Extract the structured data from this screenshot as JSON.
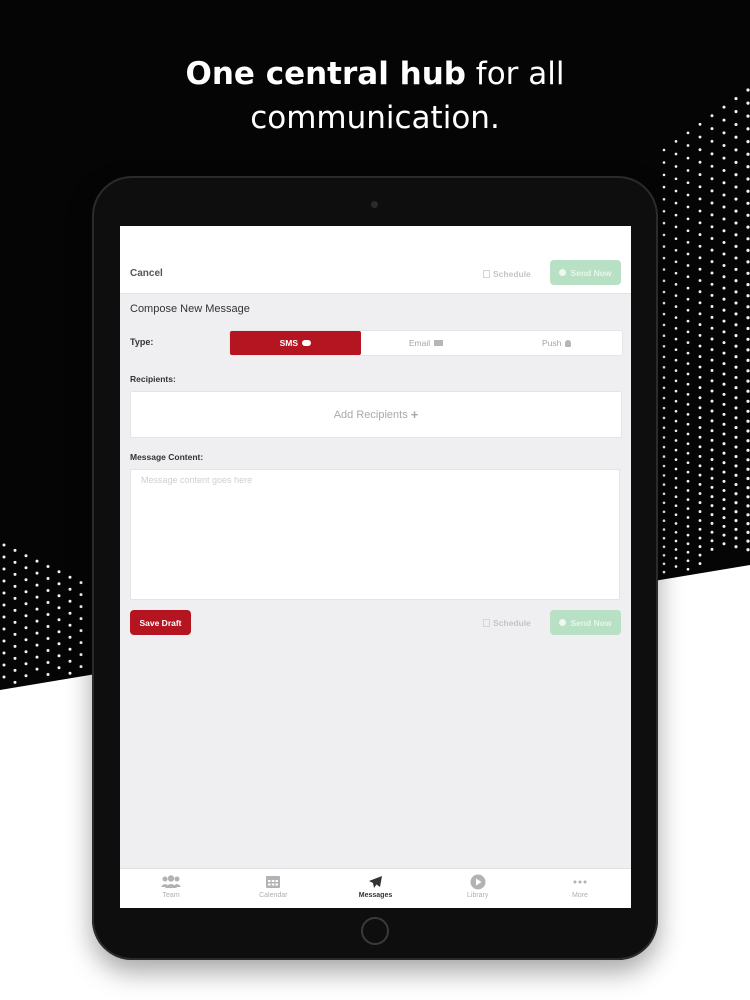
{
  "headline": {
    "bold": "One central hub",
    "rest1": " for all",
    "line2": "communication."
  },
  "topbar": {
    "cancel_label": "Cancel",
    "schedule_label": "Schedule",
    "send_now_label": "Send Now"
  },
  "compose": {
    "title": "Compose New Message",
    "type_label": "Type:",
    "types": [
      {
        "label": "SMS",
        "icon": "chat-bubble-icon",
        "selected": true
      },
      {
        "label": "Email",
        "icon": "envelope-icon",
        "selected": false
      },
      {
        "label": "Push",
        "icon": "bell-icon",
        "selected": false
      }
    ],
    "recipients_label": "Recipients:",
    "add_recipients_label": "Add Recipients",
    "message_label": "Message Content:",
    "message_placeholder": "Message content goes here",
    "message_value": ""
  },
  "bottom_actions": {
    "save_draft_label": "Save Draft",
    "schedule_label": "Schedule",
    "send_now_label": "Send Now"
  },
  "tabbar": {
    "tabs": [
      {
        "label": "Team",
        "icon": "team-icon",
        "active": false
      },
      {
        "label": "Calendar",
        "icon": "calendar-icon",
        "active": false
      },
      {
        "label": "Messages",
        "icon": "paper-plane-icon",
        "active": true
      },
      {
        "label": "Library",
        "icon": "play-circle-icon",
        "active": false
      },
      {
        "label": "More",
        "icon": "more-dots-icon",
        "active": false
      }
    ]
  },
  "colors": {
    "accent_red": "#b51521",
    "send_green_disabled": "#b7e0c4",
    "background_dark": "#050505"
  }
}
